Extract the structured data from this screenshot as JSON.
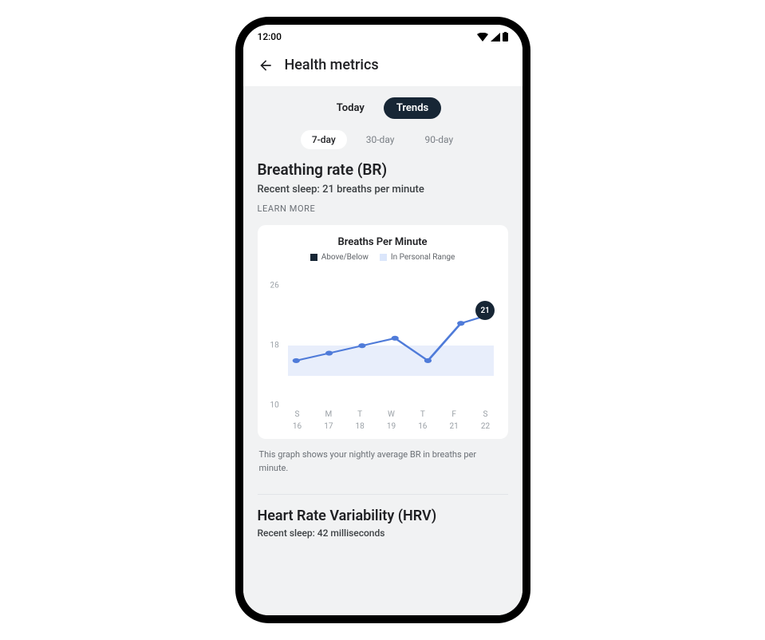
{
  "status_bar": {
    "time": "12:00"
  },
  "header": {
    "title": "Health metrics"
  },
  "tabs": {
    "today": "Today",
    "trends": "Trends"
  },
  "ranges": {
    "r7": "7-day",
    "r30": "30-day",
    "r90": "90-day"
  },
  "breathing": {
    "title": "Breathing rate (BR)",
    "subtitle": "Recent sleep: 21 breaths per minute",
    "learn_more": "LEARN MORE",
    "chart_title": "Breaths Per Minute",
    "legend_above": "Above/Below",
    "legend_range": "In Personal Range",
    "caption": "This graph shows your nightly average BR in breaths per minute.",
    "marker_value": "21"
  },
  "hrv": {
    "title": "Heart Rate Variability (HRV)",
    "subtitle": "Recent sleep: 42 milliseconds"
  },
  "chart_data": {
    "type": "line",
    "title": "Breaths Per Minute",
    "ylabel": "",
    "xlabel": "",
    "ylim": [
      10,
      26
    ],
    "yticks": [
      10,
      18,
      26
    ],
    "personal_range": [
      14,
      18
    ],
    "categories": [
      "S",
      "M",
      "T",
      "W",
      "T",
      "F",
      "S"
    ],
    "series": [
      {
        "name": "Breaths Per Minute",
        "values": [
          16,
          17,
          18,
          19,
          16,
          21,
          22
        ]
      }
    ],
    "highlight_index": 6,
    "highlight_value": 21,
    "legend": [
      "Above/Below",
      "In Personal Range"
    ]
  }
}
